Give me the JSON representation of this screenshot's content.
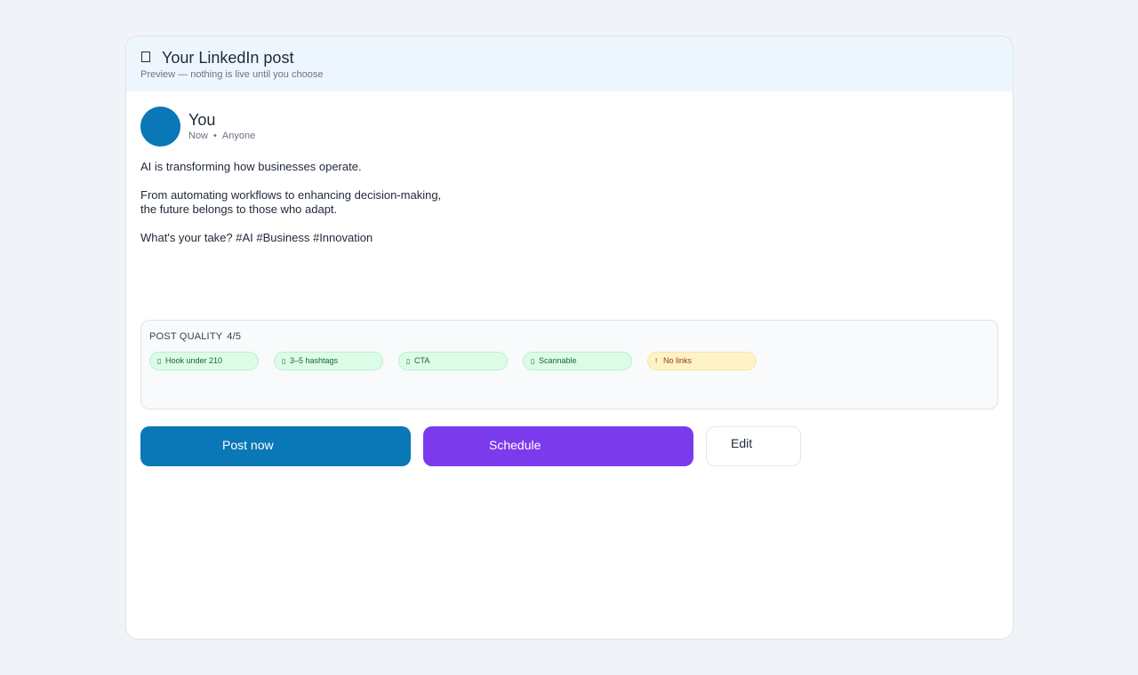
{
  "header": {
    "icon": "document-icon",
    "title": "Your LinkedIn post",
    "subtitle": "Preview — nothing is live until you choose"
  },
  "author": {
    "name": "You",
    "time": "Now",
    "separator": "•",
    "visibility": "Anyone",
    "avatar_color": "#0a77b6"
  },
  "post": {
    "paragraphs": [
      "AI is transforming how businesses operate.",
      "From automating workflows to enhancing decision-making,\nthe future belongs to those who adapt.",
      "What's your take? #AI #Business #Innovation"
    ]
  },
  "quality": {
    "label": "POST QUALITY",
    "score": "4/5",
    "checks": [
      {
        "icon": "check-icon",
        "label": "Hook under 210",
        "status": "pass"
      },
      {
        "icon": "check-icon",
        "label": "3–5 hashtags",
        "status": "pass"
      },
      {
        "icon": "check-icon",
        "label": "CTA",
        "status": "pass"
      },
      {
        "icon": "check-icon",
        "label": "Scannable",
        "status": "pass"
      },
      {
        "icon_glyph": "!",
        "icon": "warning-icon",
        "label": "No links",
        "status": "warn"
      }
    ]
  },
  "actions": {
    "post_now": "Post now",
    "schedule": "Schedule",
    "edit": "Edit"
  },
  "colors": {
    "linkedin_blue": "#0a77b6",
    "schedule_purple": "#7c3aed",
    "pass_bg": "#dcfce7",
    "warn_bg": "#fef3c7"
  }
}
